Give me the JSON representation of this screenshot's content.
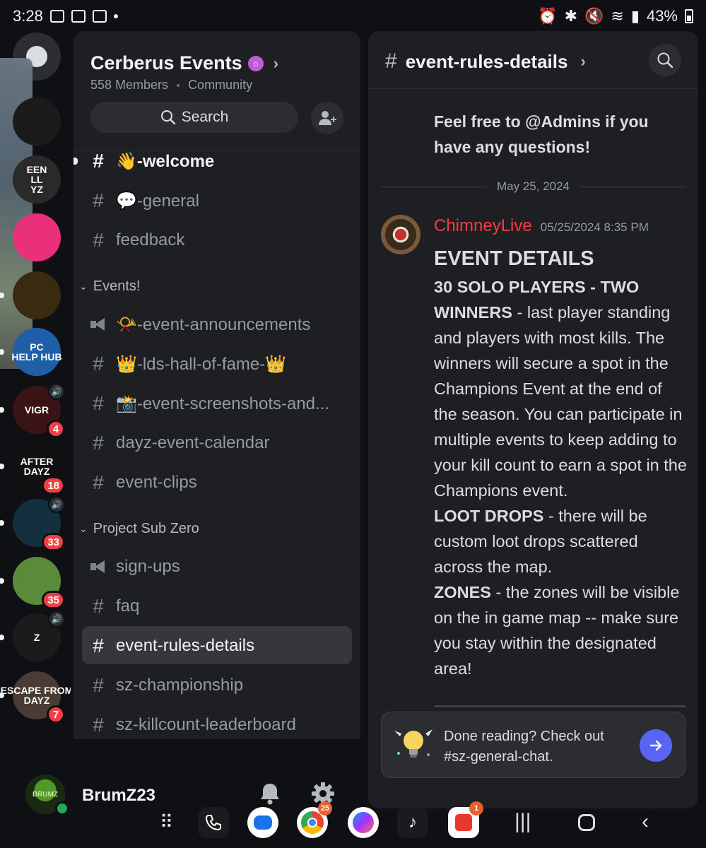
{
  "status_bar": {
    "time": "3:28",
    "battery": "43%"
  },
  "server_rail": {
    "servers": [
      {
        "name": "ghost-server",
        "label": "",
        "color": "#1b1b1b"
      },
      {
        "name": "green-hill-dayz",
        "label": "EEN\nLL\nYZ",
        "color": "#2a2a2a"
      },
      {
        "name": "pink-heart-server",
        "label": "",
        "color": "#ea2f7b"
      },
      {
        "name": "banana-gaming",
        "label": "",
        "color": "#3a2a12"
      },
      {
        "name": "pc-help-hub",
        "label": "PC\nHELP HUB",
        "color": "#1e5fa8"
      },
      {
        "name": "vigr-server",
        "label": "VIGR",
        "color": "#3b1216",
        "badge": "4"
      },
      {
        "name": "after-dayz",
        "label": "AFTER\nDAYZ",
        "color": "#111111",
        "badge": "18"
      },
      {
        "name": "atom-server",
        "label": "",
        "color": "#14303f",
        "badge": "33"
      },
      {
        "name": "zombie-server",
        "label": "",
        "color": "#5a8a3a",
        "badge": "35"
      },
      {
        "name": "z-server",
        "label": "Z",
        "color": "#1b1b1b"
      },
      {
        "name": "escape-from-dayz",
        "label": "ESCAPE FROM\nDAYZ",
        "color": "#4a3c34",
        "badge": "7"
      }
    ]
  },
  "server": {
    "name": "Cerberus Events",
    "members": "558 Members",
    "type": "Community",
    "search_label": "Search"
  },
  "channels": {
    "top": [
      {
        "emoji": "👋",
        "name": "-welcome"
      },
      {
        "emoji": "💬",
        "name": "-general"
      },
      {
        "emoji": "",
        "name": "feedback"
      }
    ],
    "category1": "Events!",
    "events": [
      {
        "emoji": "📯",
        "name": "-event-announcements"
      },
      {
        "emoji": "👑",
        "name": "-lds-hall-of-fame-👑"
      },
      {
        "emoji": "📸",
        "name": "-event-screenshots-and..."
      },
      {
        "emoji": "",
        "name": "dayz-event-calendar"
      },
      {
        "emoji": "",
        "name": "event-clips"
      }
    ],
    "category2": "Project Sub Zero",
    "subzero": [
      {
        "name": "sign-ups"
      },
      {
        "name": "faq"
      },
      {
        "name": "event-rules-details"
      },
      {
        "name": "sz-championship"
      },
      {
        "name": "sz-killcount-leaderboard"
      }
    ]
  },
  "chat": {
    "channel": "event-rules-details",
    "prev_message": "Feel free to @Admins if you have any questions!",
    "date_divider": "May 25, 2024",
    "author": "ChimneyLive",
    "timestamp": "05/25/2024 8:35 PM",
    "heading": "EVENT DETAILS",
    "p1_bold": "30 SOLO PLAYERS - TWO WINNERS",
    "p1_text": " - last player standing and players with most kills. The winners will secure a spot in the Champions Event at the end of the season. You can participate in multiple events to keep adding to your kill count to earn a spot in the Champions event.",
    "p2_bold": "LOOT DROPS",
    "p2_text": " - there will be custom loot drops scattered across the map.",
    "p3_bold": "ZONES",
    "p3_text": " - the zones will be visible on the in game map -- make sure you stay within the designated area!",
    "prompt": "Done reading? Check out #sz-general-chat."
  },
  "user": {
    "name": "BrumZ23",
    "avatar_text": "BRUMZ"
  },
  "dock": {
    "chrome_badge": "25",
    "shop_badge": "1"
  }
}
